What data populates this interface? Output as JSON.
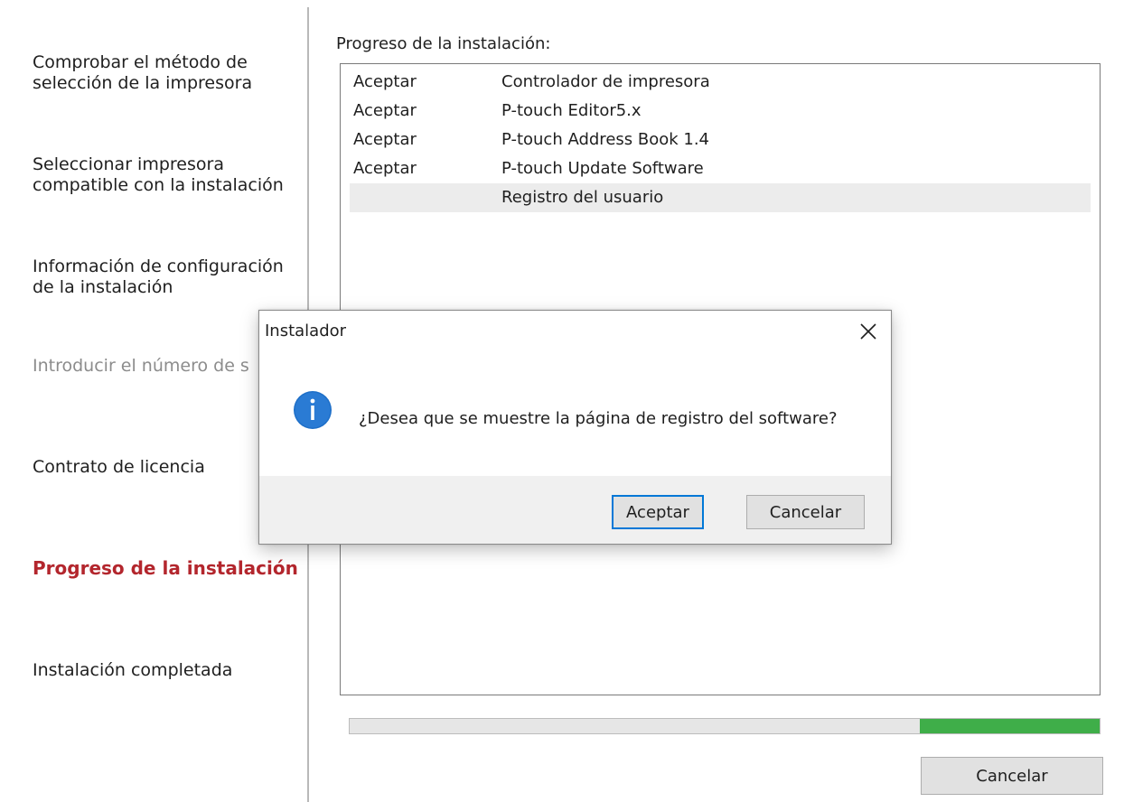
{
  "sidebar": {
    "steps": [
      {
        "lines": [
          "Comprobar el método de",
          "selección de la impresora"
        ]
      },
      {
        "lines": [
          "Seleccionar impresora",
          "compatible con la instalación"
        ]
      },
      {
        "lines": [
          "Información de configuración",
          "de la instalación"
        ]
      },
      {
        "lines": [
          "Introducir el número de s"
        ]
      },
      {
        "lines": [
          "Contrato de licencia"
        ]
      },
      {
        "lines": [
          "Progreso de la instalación"
        ]
      },
      {
        "lines": [
          "Instalación completada"
        ]
      }
    ]
  },
  "main": {
    "heading": "Progreso de la instalación:",
    "items": [
      {
        "status": "Aceptar",
        "name": "Controlador de impresora"
      },
      {
        "status": "Aceptar",
        "name": "P-touch Editor5.x"
      },
      {
        "status": "Aceptar",
        "name": "P-touch Address Book 1.4"
      },
      {
        "status": "Aceptar",
        "name": "P-touch Update Software"
      },
      {
        "status": "",
        "name": "Registro del usuario"
      }
    ],
    "progress_fraction": 0.24,
    "cancel_label": "Cancelar"
  },
  "dialog": {
    "title": "Instalador",
    "message": "¿Desea que se muestre la página de registro del software?",
    "ok_label": "Aceptar",
    "cancel_label": "Cancelar",
    "icon": "info-icon"
  },
  "colors": {
    "current_step": "#b3262d",
    "progress_fill": "#3fae49",
    "info_icon": "#1e6fc8",
    "default_button_border": "#0078d7"
  }
}
